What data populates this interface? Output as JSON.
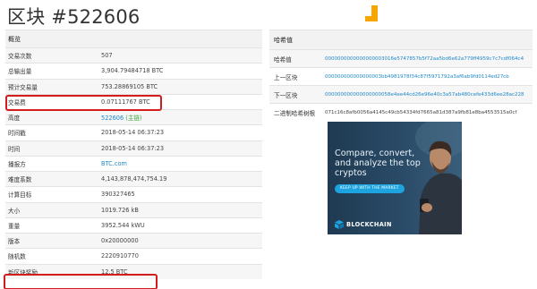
{
  "page": {
    "title": "区块 #522606"
  },
  "overview": {
    "header": "概览",
    "rows": [
      {
        "label": "交易次数",
        "value": "507"
      },
      {
        "label": "总输出量",
        "value": "3,904.79484718 BTC"
      },
      {
        "label": "预计交易量",
        "value": "753.28869105 BTC"
      },
      {
        "label": "交易费",
        "value": "0.07111767 BTC"
      },
      {
        "label": "高度",
        "value": "522606",
        "tag": "(主链)"
      },
      {
        "label": "时间戳",
        "value": "2018-05-14 06:37:23"
      },
      {
        "label": "时间",
        "value": "2018-05-14 06:37:23"
      },
      {
        "label": "播报方",
        "value": "BTC.com"
      },
      {
        "label": "难度系数",
        "value": "4,143,878,474,754.19"
      },
      {
        "label": "计算目标",
        "value": "390327465"
      },
      {
        "label": "大小",
        "value": "1019.726 kB"
      },
      {
        "label": "重量",
        "value": "3952.544 kWU"
      },
      {
        "label": "版本",
        "value": "0x20000000"
      },
      {
        "label": "随机数",
        "value": "2220910770"
      },
      {
        "label": "新区块奖励",
        "value": "12.5 BTC"
      }
    ]
  },
  "hashes": {
    "header": "哈希值",
    "rows": [
      {
        "label": "哈希值",
        "value": "0000000000000000003016e5747857b5f72aa5bd6e62a779ff4959c7c7cdf064c4"
      },
      {
        "label": "上一区块",
        "value": "000000000000000003bb4981978f34c87f5971792a3af6ab9fd0114ed27cb"
      },
      {
        "label": "下一区块",
        "value": "000000000000000000058e4ee44cd26e96e40c3a57ab480cefe433d6ee28ac228"
      },
      {
        "label": "二进制哈希树根",
        "value": "071c16c8afb0056a4145c49cb54334fd7665a81d387a9fb81e8ba4553515a0cf"
      }
    ]
  },
  "ad": {
    "headline": "Compare, convert, and analyze the top cryptos",
    "button": "KEEP UP WITH THE MARKET",
    "brand": "BLOCKCHAIN"
  },
  "colors": {
    "link": "#1e88c8",
    "main_chain": "#3ba33b",
    "highlight_box": "#d21d1d",
    "logo": "#f7a600"
  }
}
